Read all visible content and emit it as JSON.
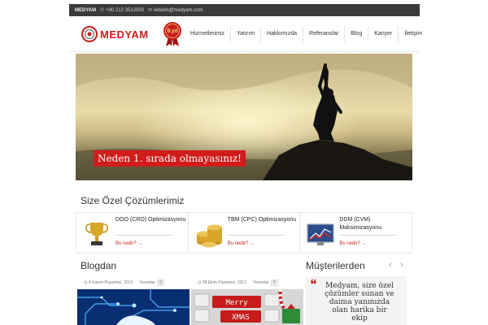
{
  "topbar": {
    "brand": "MEDYAM",
    "phone_icon": "phone-icon",
    "phone": "+90 212 3512000",
    "email_icon": "envelope-icon",
    "email": "iletisim@medyam.com"
  },
  "header": {
    "logo_text": "MEDYAM",
    "badge_text": "9.yıl",
    "nav": [
      "Hizmetlerimiz",
      "Yatırım",
      "Hakkımızda",
      "Referanslar",
      "Blog",
      "Kariyer",
      "İletişim"
    ]
  },
  "hero": {
    "caption": "Neden 1. sırada olmayasınız!"
  },
  "solutions": {
    "title": "Size Özel Çözümlerimiz",
    "items": [
      {
        "title": "DOO (CRO) Optimizasyonu",
        "link": "Bu nedir? →",
        "icon": "trophy-icon"
      },
      {
        "title": "TBM (CPC) Optimizasyonu",
        "link": "Bu nedir? →",
        "icon": "coins-icon"
      },
      {
        "title": "DDM (CVM) Maksimizasyonu",
        "link": "Bu nedir? →",
        "icon": "chart-monitor-icon"
      }
    ]
  },
  "blog": {
    "title": "Blogdan",
    "posts": [
      {
        "date": "4 Kasım Pazartesi, 2013",
        "comments_label": "Yorumlar",
        "comments": "0"
      },
      {
        "date": "28 Ekim Pazartesi, 2013",
        "comments_label": "Yorumlar",
        "comments": "0"
      }
    ],
    "xmas_words": [
      "Merry",
      "XMAS"
    ]
  },
  "clients": {
    "title": "Müşterilerden",
    "prev": "‹",
    "next": "›",
    "quote_mark": "❝",
    "quote": "Medyam, size özel çözümler sunan ve daima yanınızda olan harika bir ekip"
  },
  "colors": {
    "accent": "#c81f1f",
    "topbar": "#3a3a3a"
  }
}
